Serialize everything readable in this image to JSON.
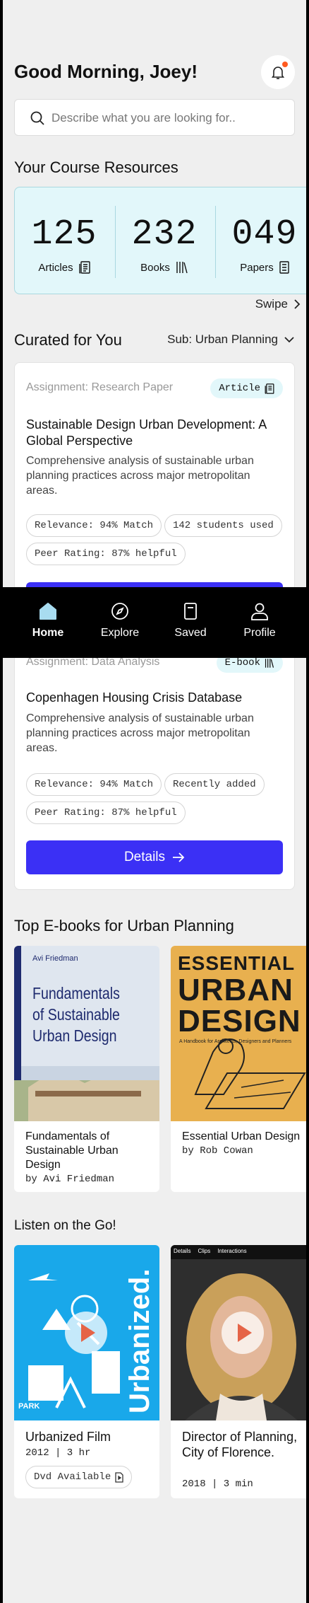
{
  "header": {
    "greeting": "Good Morning, Joey!"
  },
  "search": {
    "placeholder": "Describe what you are looking for.."
  },
  "resources": {
    "title": "Your Course Resources",
    "stats": [
      {
        "value": "125",
        "label": "Articles",
        "icon": "article-icon"
      },
      {
        "value": "232",
        "label": "Books",
        "icon": "books-icon"
      },
      {
        "value": "049",
        "label": "Papers",
        "icon": "papers-icon"
      }
    ],
    "swipe_label": "Swipe"
  },
  "curated": {
    "title": "Curated for You",
    "filter_label": "Sub: Urban Planning",
    "cards": [
      {
        "type": "Assignment: Research Paper",
        "badge": "Article",
        "title": "Sustainable Design Urban Development: A Global Perspective",
        "description": "Comprehensive analysis of sustainable urban planning practices across major metropolitan areas.",
        "chips": [
          "Relevance: 94% Match",
          "142 students used",
          "Peer Rating: 87% helpful"
        ]
      },
      {
        "type": "Assignment: Data Analysis",
        "badge": "E-book",
        "title": "Copenhagen Housing Crisis Database",
        "description": "Comprehensive analysis of sustainable urban planning practices across major metropolitan areas.",
        "chips": [
          "Relevance: 94% Match",
          "Recently added",
          "Peer Rating: 87% helpful"
        ],
        "cta": "Details"
      }
    ]
  },
  "nav": {
    "items": [
      {
        "label": "Home",
        "icon": "home-icon",
        "active": true
      },
      {
        "label": "Explore",
        "icon": "compass-icon"
      },
      {
        "label": "Saved",
        "icon": "bookmark-icon"
      },
      {
        "label": "Profile",
        "icon": "user-icon"
      }
    ]
  },
  "ebooks": {
    "title": "Top E-books for Urban Planning",
    "items": [
      {
        "title": "Fundamentals of Sustainable Urban Design",
        "author": "by Avi Friedman",
        "cover_author": "Avi Friedman",
        "cover_title_lines": [
          "Fundamentals",
          "of Sustainable",
          "Urban Design"
        ]
      },
      {
        "title": "Essential Urban Design",
        "author": "by Rob Cowan",
        "cover_title_lines": [
          "ESSENTIAL",
          "URBAN",
          "DESIGN"
        ],
        "cover_subtitle": "A Handbook for Architects, Designers and Planners"
      }
    ]
  },
  "listen": {
    "title": "Listen on the Go!",
    "items": [
      {
        "title": "Urbanized Film",
        "meta": "2012 | 3 hr",
        "chip": "Dvd Available",
        "cover_text": "Urbanized.",
        "cover_small_text": "PARK"
      },
      {
        "title": "Director of Planning, City of Florence.",
        "meta": "2018 | 3 min",
        "tabs": [
          "Details",
          "Clips",
          "Interactions"
        ]
      }
    ]
  },
  "colors": {
    "accent": "#3b30f5",
    "stats_bg": "#e2f7fa",
    "notification": "#ff5a1f"
  }
}
